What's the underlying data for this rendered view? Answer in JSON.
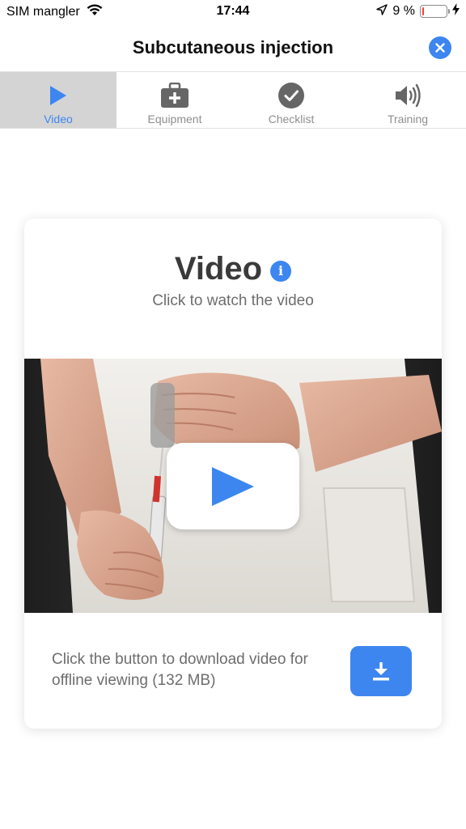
{
  "status_bar": {
    "carrier": "SIM mangler",
    "time": "17:44",
    "battery_percent": "9 %",
    "battery_level": 0.09
  },
  "header": {
    "title": "Subcutaneous injection",
    "close_icon": "close-icon"
  },
  "tabs": [
    {
      "label": "Video",
      "icon": "play-icon",
      "active": true
    },
    {
      "label": "Equipment",
      "icon": "first-aid-kit-icon",
      "active": false
    },
    {
      "label": "Checklist",
      "icon": "checkmark-circle-icon",
      "active": false
    },
    {
      "label": "Training",
      "icon": "speaker-icon",
      "active": false
    }
  ],
  "card": {
    "title": "Video",
    "subtitle": "Click to watch the video",
    "download_text": "Click the button to download video for offline viewing (132 MB)",
    "download_icon": "download-icon"
  },
  "colors": {
    "accent": "#3d86f0",
    "active_tab_bg": "#d4d4d4",
    "battery_low": "#ff3b30"
  }
}
